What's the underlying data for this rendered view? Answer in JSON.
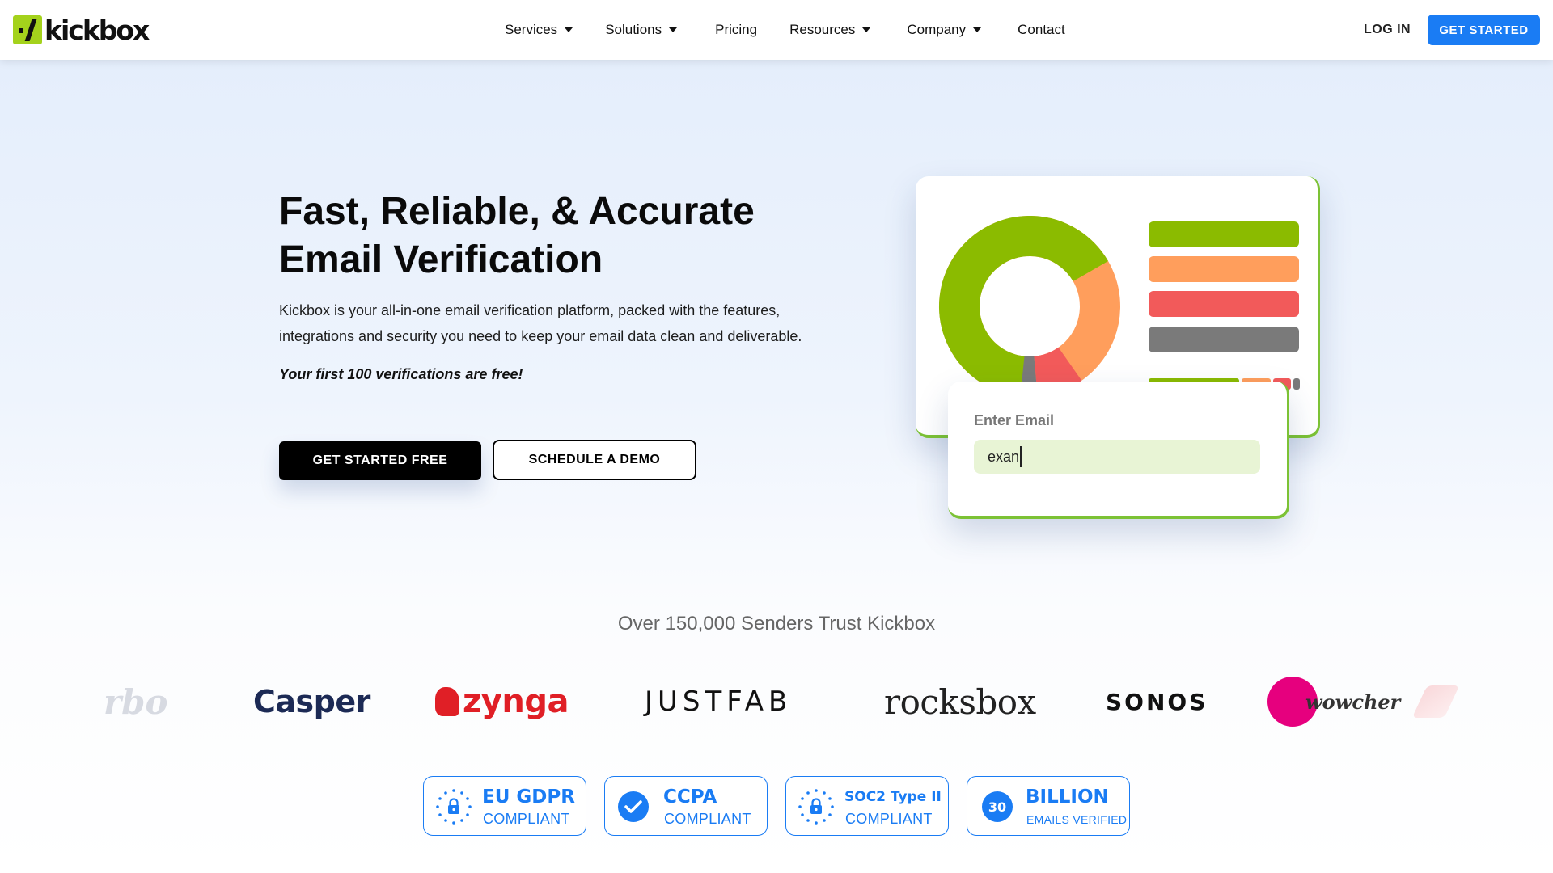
{
  "brand": {
    "name": "kickbox"
  },
  "nav": {
    "items": [
      {
        "label": "Services",
        "dropdown": true
      },
      {
        "label": "Solutions",
        "dropdown": true
      },
      {
        "label": "Pricing",
        "dropdown": false
      },
      {
        "label": "Resources",
        "dropdown": true
      },
      {
        "label": "Company",
        "dropdown": true
      },
      {
        "label": "Contact",
        "dropdown": false
      }
    ],
    "login_label": "LOG IN",
    "cta_label": "GET STARTED"
  },
  "hero": {
    "title_line1": "Fast, Reliable, & Accurate",
    "title_line2": "Email Verification",
    "description_line1": "Kickbox is your all-in-one email verification platform, packed with the features,",
    "description_line2": "integrations and security you need to keep your email data clean and deliverable.",
    "free_note": "Your first 100 verifications are free!",
    "primary_cta": "GET STARTED FREE",
    "secondary_cta": "SCHEDULE A DEMO"
  },
  "illustration": {
    "email_label": "Enter Email",
    "email_value": "exan",
    "donut_colors": [
      "#8bbb00",
      "#ff9e5c",
      "#f25a5a",
      "#7a7a7a"
    ],
    "bar_colors": [
      "#8bbb00",
      "#ff9e5c",
      "#f25a5a",
      "#7a7a7a"
    ]
  },
  "trust": {
    "title": "Over 150,000 Senders Trust Kickbox",
    "logos": [
      "rbo",
      "Casper",
      "zynga",
      "JUSTFAB",
      "rocksbox",
      "SONOS",
      "wowcher"
    ]
  },
  "badges": [
    {
      "title": "EU GDPR",
      "subtitle": "COMPLIANT",
      "icon": "lock-stars-icon"
    },
    {
      "title": "CCPA",
      "subtitle": "COMPLIANT",
      "icon": "check-circle-icon"
    },
    {
      "title": "SOC2 Type II",
      "subtitle": "COMPLIANT",
      "icon": "lock-stars-icon"
    },
    {
      "title": "BILLION",
      "subtitle": "EMAILS VERIFIED",
      "icon_text": "30"
    }
  ],
  "colors": {
    "accent_blue": "#1a7cf4",
    "brand_green": "#a4d21c",
    "card_green_border": "#7cc235"
  }
}
